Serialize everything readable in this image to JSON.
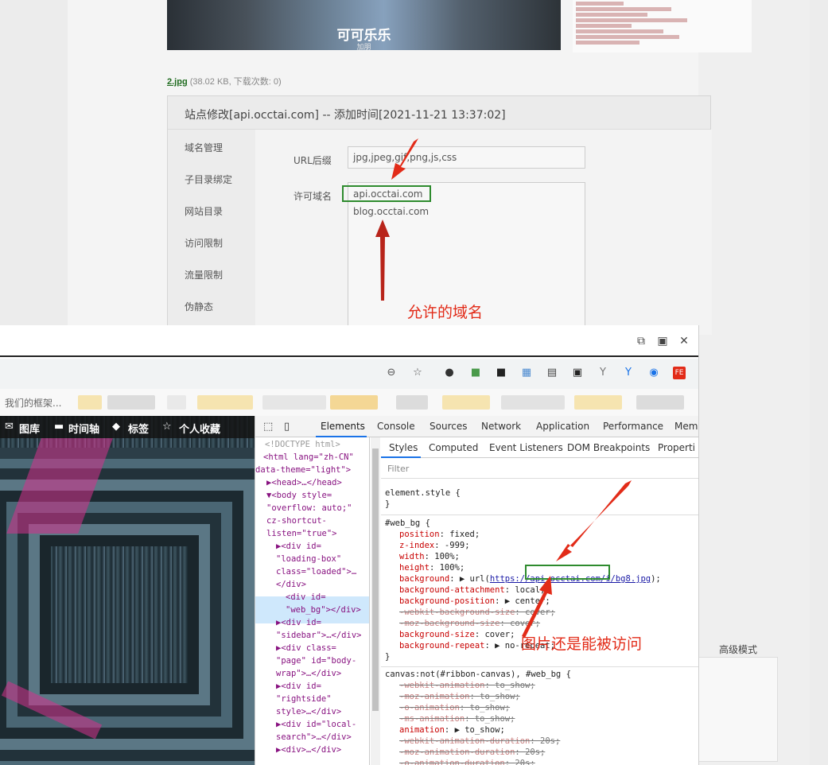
{
  "background_page": {
    "thumb_title": "可可乐乐",
    "thumb_subtitle": "加朋",
    "file_link": "2.jpg",
    "file_meta": " (38.02 KB, 下载次数: 0)",
    "advanced_mode": "高级模式"
  },
  "site_panel": {
    "header": "站点修改[api.occtai.com] -- 添加时间[2021-11-21 13:37:02]",
    "nav_items": [
      "域名管理",
      "子目录绑定",
      "网站目录",
      "访问限制",
      "流量限制",
      "伪静态"
    ],
    "url_suffix_label": "URL后缀",
    "url_suffix_value": "jpg,jpeg,gif,png,js,css",
    "allowed_domain_label": "许可域名",
    "allowed_domains": [
      "api.occtai.com",
      "blog.occtai.com"
    ]
  },
  "annotations": {
    "allowed_note": "允许的域名",
    "still_access_note": "图片还是能被访问",
    "arrow_color": "#e22b18",
    "highlight_color": "#2e8b2e"
  },
  "browser": {
    "bookmark_text": "我们的框架...",
    "site_nav": [
      "图库",
      "时间轴",
      "标签",
      "个人收藏"
    ],
    "window_buttons": [
      "popout-icon",
      "maximize-icon",
      "close-icon"
    ]
  },
  "devtools": {
    "main_tabs": [
      "Elements",
      "Console",
      "Sources",
      "Network",
      "Application",
      "Performance",
      "Mem"
    ],
    "active_main_tab": "Elements",
    "sub_tabs": [
      "Styles",
      "Computed",
      "Event Listeners",
      "DOM Breakpoints",
      "Properti"
    ],
    "active_sub_tab": "Styles",
    "filter_placeholder": "Filter",
    "dom_tree": [
      "<!DOCTYPE html>",
      "<html lang=\"zh-CN\"",
      "data-theme=\"light\">",
      "▶<head>…</head>",
      "▼<body style=",
      "\"overflow: auto;\"",
      "cz-shortcut-",
      "listen=\"true\">",
      "▶<div id=",
      "\"loading-box\"",
      "class=\"loaded\">…",
      "</div>",
      "<div id=",
      "\"web_bg\"></div>",
      "▶<div id=",
      "\"sidebar\">…</div>",
      "▶<div class=",
      "\"page\" id=\"body-",
      "wrap\">…</div>",
      "▶<div id=",
      "\"rightside\"",
      "style>…</div>",
      "▶<div id=\"local-",
      "search\">…</div>",
      "▶<div>…</div>"
    ],
    "styles": {
      "element_style": "element.style {",
      "close_brace": "}",
      "web_bg_selector": "#web_bg {",
      "web_bg_rules": [
        {
          "prop": "position",
          "value": "fixed;",
          "struck": false
        },
        {
          "prop": "z-index",
          "value": "-999;",
          "struck": false
        },
        {
          "prop": "width",
          "value": "100%;",
          "struck": false
        },
        {
          "prop": "height",
          "value": "100%;",
          "struck": false
        },
        {
          "prop": "background",
          "value": "▶ url(https://api.occtai.com/i/bg8.jpg);",
          "struck": false
        },
        {
          "prop": "background-attachment",
          "value": "local;",
          "struck": false
        },
        {
          "prop": "background-position",
          "value": "▶ center;",
          "struck": false
        },
        {
          "prop": "-webkit-background-size",
          "value": "cover;",
          "struck": true
        },
        {
          "prop": "-moz-background-size",
          "value": "cover;",
          "struck": true
        },
        {
          "prop": "background-size",
          "value": "cover;",
          "struck": false
        },
        {
          "prop": "background-repeat",
          "value": "▶ no-repeat;",
          "struck": false
        }
      ],
      "bg_url": "https://api.occtai.com/i/bg8.jpg",
      "canvas_selector": "canvas:not(#ribbon-canvas), #web_bg {",
      "canvas_rules": [
        {
          "prop": "-webkit-animation",
          "value": "to_show;",
          "struck": true
        },
        {
          "prop": "-moz-animation",
          "value": "to_show;",
          "struck": true
        },
        {
          "prop": "-o-animation",
          "value": "to_show;",
          "struck": true
        },
        {
          "prop": "-ms-animation",
          "value": "to_show;",
          "struck": true
        },
        {
          "prop": "animation",
          "value": "▶ to_show;",
          "struck": false
        },
        {
          "prop": "-webkit-animation-duration",
          "value": "20s;",
          "struck": true
        },
        {
          "prop": "-moz-animation-duration",
          "value": "20s;",
          "struck": true
        },
        {
          "prop": "-o-animation-duration",
          "value": "20s;",
          "struck": true
        }
      ]
    }
  }
}
